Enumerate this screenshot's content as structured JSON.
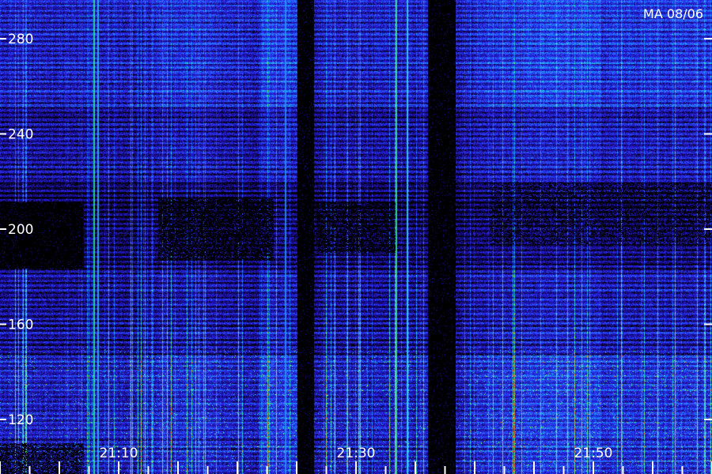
{
  "header": {
    "station_date": "MA 08/06"
  },
  "colors": {
    "background": "#000000",
    "low": "#1a0a9c",
    "mid_low": "#2a3cff",
    "mid": "#1fa8ff",
    "high": "#3cff9a",
    "peak": "#ff5a1a",
    "tick": "#ffffff",
    "text": "#ffffff"
  },
  "chart_data": {
    "type": "heatmap",
    "title": "",
    "xlabel": "",
    "ylabel": "",
    "y_ticks": [
      {
        "value": 120,
        "label": "120"
      },
      {
        "value": 160,
        "label": "160"
      },
      {
        "value": 200,
        "label": "200"
      },
      {
        "value": 240,
        "label": "240"
      },
      {
        "value": 280,
        "label": "280"
      }
    ],
    "x_ticks": [
      {
        "value": "21:10",
        "label": "21:10"
      },
      {
        "value": "21:30",
        "label": "21:30"
      },
      {
        "value": "21:50",
        "label": "21:50"
      }
    ],
    "grid": false,
    "legend": "none"
  }
}
